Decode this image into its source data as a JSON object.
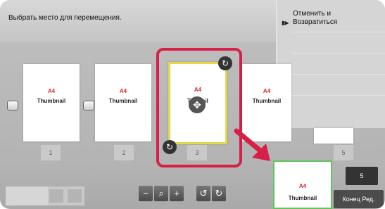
{
  "header": {
    "instruction": "Выбрать место для перемещения."
  },
  "side_panel": {
    "cancel_label": "Отменить и\nВозвратиться",
    "cancel_arrow": "▮▶"
  },
  "pages": [
    {
      "a4": "A4",
      "label": "Thumbnail",
      "number": "1"
    },
    {
      "a4": "A4",
      "label": "Thumbnail",
      "number": "2"
    },
    {
      "a4": "A4",
      "label": "Th     ail",
      "number": "3"
    },
    {
      "a4": "A4",
      "label": "Thumbnail",
      "number": ""
    },
    {
      "a4": "",
      "label": "",
      "number": "5"
    }
  ],
  "drag_preview": {
    "a4": "A4",
    "label": "Thumbnail"
  },
  "toolbar": {
    "zoom_out": "−",
    "zoom": "⌕",
    "zoom_in": "+",
    "rotate_left": "↺",
    "rotate_right": "↻"
  },
  "footer": {
    "page_count": "5",
    "end_label": "Конец Ред."
  },
  "colors": {
    "selection_frame": "#d81f48",
    "drop_target": "#5fc65a",
    "a4_text": "#d92b2b"
  }
}
